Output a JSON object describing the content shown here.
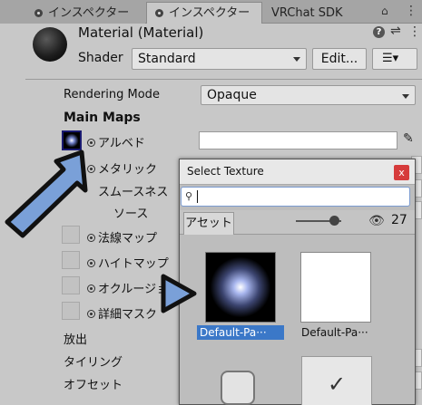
{
  "tabs": [
    {
      "label": "インスペクター",
      "active": false
    },
    {
      "label": "インスペクター",
      "active": true
    },
    {
      "label": "VRChat SDK",
      "active": false
    }
  ],
  "header": {
    "title": "Material (Material)",
    "shader_label": "Shader",
    "shader_value": "Standard",
    "edit_label": "Edit...",
    "list_icon": "☰▾"
  },
  "properties": {
    "rendering_mode_label": "Rendering Mode",
    "rendering_mode_value": "Opaque",
    "main_maps": "Main Maps",
    "albedo": "アルベド",
    "metallic": "メタリック",
    "smoothness": "スムースネス",
    "source": "ソース",
    "normal_map": "法線マップ",
    "height_map": "ハイトマップ",
    "occlusion": "オクルージョ",
    "detail_mask": "詳細マスク",
    "emission": "放出",
    "tiling": "タイリング",
    "offset": "オフセット"
  },
  "dialog": {
    "title": "Select Texture",
    "close": "x",
    "search_placeholder": "",
    "asset_tab": "アセット",
    "visible_count": "27",
    "items": [
      {
        "label": "Default-Pa···",
        "selected": true
      },
      {
        "label": "Default-Pa···",
        "selected": false
      }
    ],
    "check_glyph": "✓"
  },
  "colors": {
    "accent": "#3b78c8",
    "arrow_fill": "#7aa0d8",
    "close_red": "#d63b3b"
  }
}
